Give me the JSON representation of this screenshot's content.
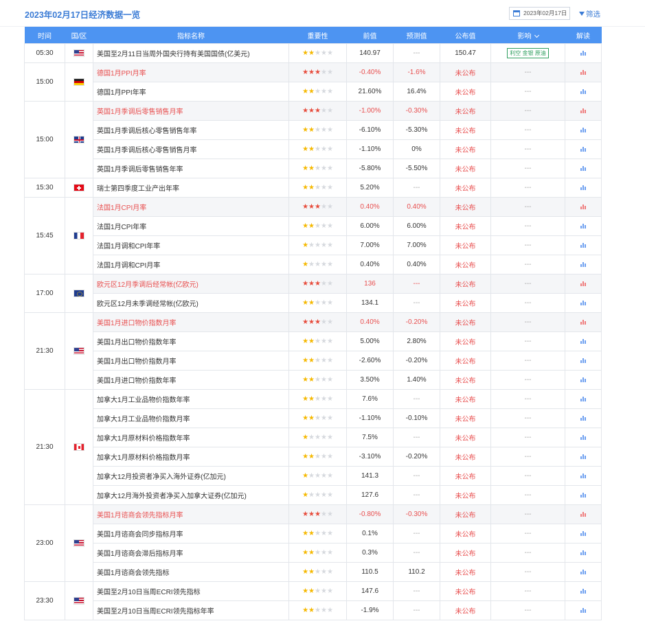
{
  "header": {
    "title": "2023年02月17日经济数据一览",
    "date": "2023年02月17日",
    "filter_label": "筛选"
  },
  "columns": {
    "time": "时间",
    "region": "国/区",
    "name": "指标名称",
    "importance": "重要性",
    "prev": "前值",
    "forecast": "预测值",
    "actual": "公布值",
    "impact": "影响",
    "analysis": "解读"
  },
  "colors": {
    "header_bg": "#4d94f2",
    "accent": "#3a7bd5",
    "bullish": "#e84e4e",
    "tag": "#2e9e5e"
  },
  "groups": [
    {
      "time": "05:30",
      "flag": "us",
      "rows": [
        {
          "name": "美国至2月11日当周外国央行持有美国国债(亿美元)",
          "stars": 2,
          "prev": "140.97",
          "forecast": "---",
          "actual": "150.47",
          "impact": "利空 金银 原油",
          "tag": true
        }
      ]
    },
    {
      "time": "15:00",
      "flag": "de",
      "rows": [
        {
          "name": "德国1月PPI月率",
          "stars": 3,
          "highlight": true,
          "prev": "-0.40%",
          "forecast": "-1.6%",
          "actual": "未公布",
          "impact": "---"
        },
        {
          "name": "德国1月PPI年率",
          "stars": 2,
          "prev": "21.60%",
          "forecast": "16.4%",
          "actual": "未公布",
          "impact": "---"
        }
      ]
    },
    {
      "time": "15:00",
      "flag": "uk",
      "rows": [
        {
          "name": "英国1月季调后零售销售月率",
          "stars": 3,
          "highlight": true,
          "prev": "-1.00%",
          "forecast": "-0.30%",
          "actual": "未公布",
          "impact": "---"
        },
        {
          "name": "英国1月季调后核心零售销售年率",
          "stars": 2,
          "prev": "-6.10%",
          "forecast": "-5.30%",
          "actual": "未公布",
          "impact": "---"
        },
        {
          "name": "英国1月季调后核心零售销售月率",
          "stars": 2,
          "prev": "-1.10%",
          "forecast": "0%",
          "actual": "未公布",
          "impact": "---"
        },
        {
          "name": "英国1月季调后零售销售年率",
          "stars": 2,
          "prev": "-5.80%",
          "forecast": "-5.50%",
          "actual": "未公布",
          "impact": "---"
        }
      ]
    },
    {
      "time": "15:30",
      "flag": "ch",
      "rows": [
        {
          "name": "瑞士第四季度工业产出年率",
          "stars": 2,
          "prev": "5.20%",
          "forecast": "---",
          "actual": "未公布",
          "impact": "---"
        }
      ]
    },
    {
      "time": "15:45",
      "flag": "fr",
      "rows": [
        {
          "name": "法国1月CPI月率",
          "stars": 3,
          "highlight": true,
          "prev": "0.40%",
          "forecast": "0.40%",
          "actual": "未公布",
          "impact": "---"
        },
        {
          "name": "法国1月CPI年率",
          "stars": 2,
          "prev": "6.00%",
          "forecast": "6.00%",
          "actual": "未公布",
          "impact": "---"
        },
        {
          "name": "法国1月调和CPI年率",
          "stars": 1,
          "prev": "7.00%",
          "forecast": "7.00%",
          "actual": "未公布",
          "impact": "---"
        },
        {
          "name": "法国1月调和CPI月率",
          "stars": 1,
          "prev": "0.40%",
          "forecast": "0.40%",
          "actual": "未公布",
          "impact": "---"
        }
      ]
    },
    {
      "time": "17:00",
      "flag": "eu",
      "rows": [
        {
          "name": "欧元区12月季调后经常帐(亿欧元)",
          "stars": 3,
          "highlight": true,
          "prev": "136",
          "forecast": "---",
          "actual": "未公布",
          "impact": "---"
        },
        {
          "name": "欧元区12月未季调经常帐(亿欧元)",
          "stars": 2,
          "prev": "134.1",
          "forecast": "---",
          "actual": "未公布",
          "impact": "---"
        }
      ]
    },
    {
      "time": "21:30",
      "flag": "us",
      "rows": [
        {
          "name": "美国1月进口物价指数月率",
          "stars": 3,
          "highlight": true,
          "prev": "0.40%",
          "forecast": "-0.20%",
          "actual": "未公布",
          "impact": "---"
        },
        {
          "name": "美国1月出口物价指数年率",
          "stars": 2,
          "prev": "5.00%",
          "forecast": "2.80%",
          "actual": "未公布",
          "impact": "---"
        },
        {
          "name": "美国1月出口物价指数月率",
          "stars": 2,
          "prev": "-2.60%",
          "forecast": "-0.20%",
          "actual": "未公布",
          "impact": "---"
        },
        {
          "name": "美国1月进口物价指数年率",
          "stars": 2,
          "prev": "3.50%",
          "forecast": "1.40%",
          "actual": "未公布",
          "impact": "---"
        }
      ]
    },
    {
      "time": "21:30",
      "flag": "ca",
      "rows": [
        {
          "name": "加拿大1月工业品物价指数年率",
          "stars": 2,
          "prev": "7.6%",
          "forecast": "---",
          "actual": "未公布",
          "impact": "---"
        },
        {
          "name": "加拿大1月工业品物价指数月率",
          "stars": 2,
          "prev": "-1.10%",
          "forecast": "-0.10%",
          "actual": "未公布",
          "impact": "---"
        },
        {
          "name": "加拿大1月原材料价格指数年率",
          "stars": 1,
          "prev": "7.5%",
          "forecast": "---",
          "actual": "未公布",
          "impact": "---"
        },
        {
          "name": "加拿大1月原材料价格指数月率",
          "stars": 2,
          "prev": "-3.10%",
          "forecast": "-0.20%",
          "actual": "未公布",
          "impact": "---"
        },
        {
          "name": "加拿大12月投资者净买入海外证券(亿加元)",
          "stars": 1,
          "prev": "141.3",
          "forecast": "---",
          "actual": "未公布",
          "impact": "---"
        },
        {
          "name": "加拿大12月海外投资者净买入加拿大证券(亿加元)",
          "stars": 1,
          "prev": "127.6",
          "forecast": "---",
          "actual": "未公布",
          "impact": "---"
        }
      ]
    },
    {
      "time": "23:00",
      "flag": "us",
      "rows": [
        {
          "name": "美国1月谘商会领先指标月率",
          "stars": 3,
          "highlight": true,
          "prev": "-0.80%",
          "forecast": "-0.30%",
          "actual": "未公布",
          "impact": "---"
        },
        {
          "name": "美国1月谘商会同步指标月率",
          "stars": 2,
          "prev": "0.1%",
          "forecast": "---",
          "actual": "未公布",
          "impact": "---"
        },
        {
          "name": "美国1月谘商会滞后指标月率",
          "stars": 2,
          "prev": "0.3%",
          "forecast": "---",
          "actual": "未公布",
          "impact": "---"
        },
        {
          "name": "美国1月谘商会领先指标",
          "stars": 2,
          "prev": "110.5",
          "forecast": "110.2",
          "actual": "未公布",
          "impact": "---"
        }
      ]
    },
    {
      "time": "23:30",
      "flag": "us",
      "rows": [
        {
          "name": "美国至2月10日当周ECRI领先指标",
          "stars": 2,
          "prev": "147.6",
          "forecast": "---",
          "actual": "未公布",
          "impact": "---"
        },
        {
          "name": "美国至2月10日当周ECRI领先指标年率",
          "stars": 2,
          "prev": "-1.9%",
          "forecast": "---",
          "actual": "未公布",
          "impact": "---"
        }
      ]
    }
  ]
}
